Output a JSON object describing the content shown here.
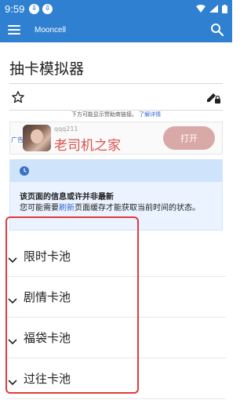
{
  "status_bar": {
    "time": "9:59"
  },
  "app_bar": {
    "title": "Mooncell"
  },
  "page": {
    "title": "抽卡模拟器"
  },
  "ad_notice": {
    "text": "下方可能显示赞助商链接。",
    "link": "了解详情"
  },
  "ad": {
    "tag": "广告",
    "small_text": "qqq211",
    "headline": "老司机之家",
    "button": "打开"
  },
  "notice": {
    "title": "该页面的信息或许并非最新",
    "text_before": "您可能需要",
    "link": "刷新",
    "text_after": "页面缓存才能获取当前时间的状态。"
  },
  "pools": [
    {
      "label": "限时卡池"
    },
    {
      "label": "剧情卡池"
    },
    {
      "label": "福袋卡池"
    },
    {
      "label": "过往卡池"
    }
  ],
  "colors": {
    "primary": "#2f80d1",
    "highlight": "#e03a3a",
    "link": "#3366cc"
  }
}
